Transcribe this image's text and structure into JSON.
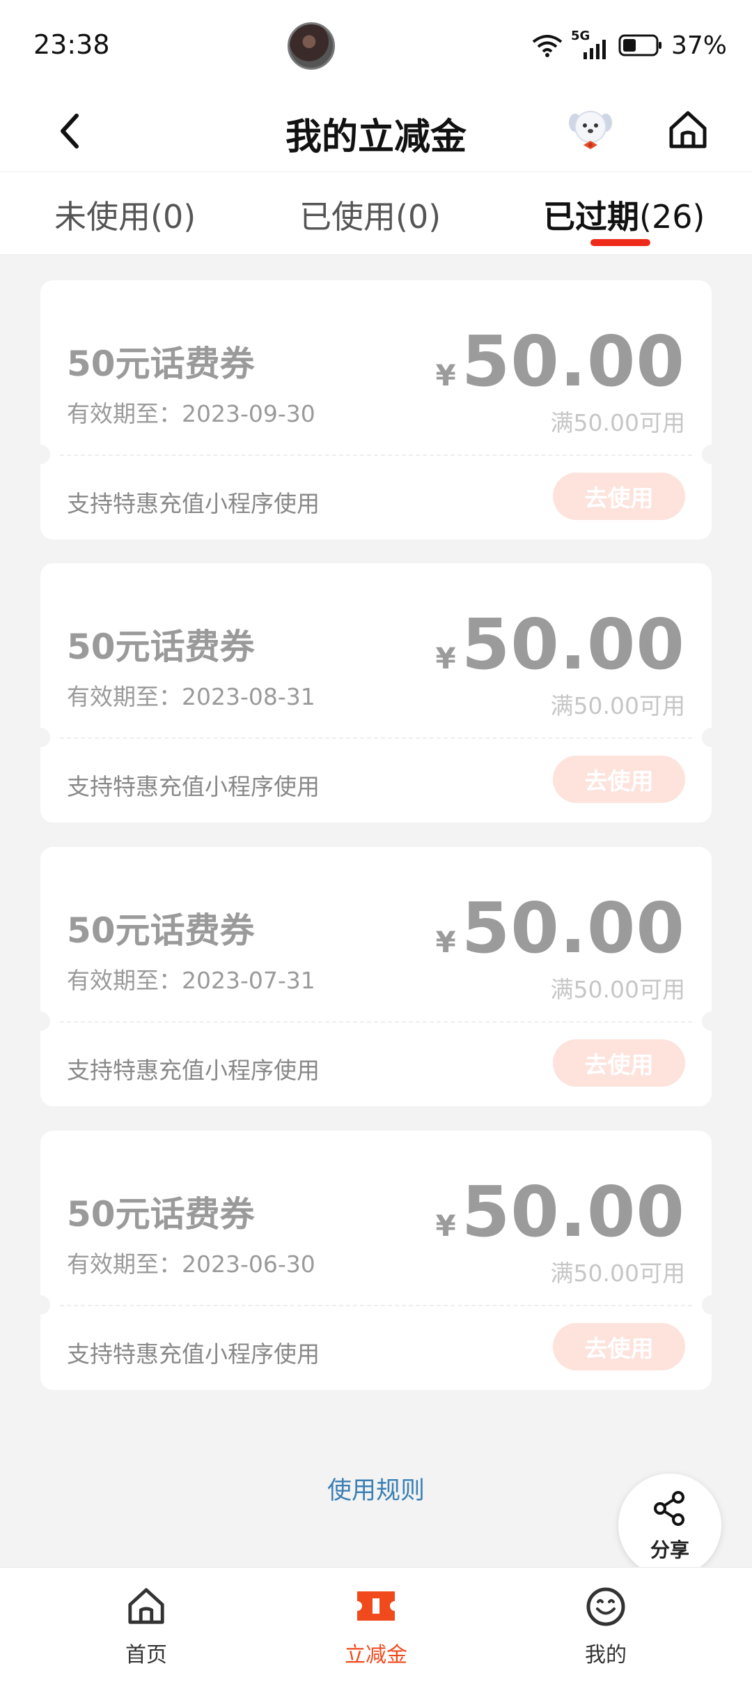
{
  "status": {
    "time": "23:38",
    "network": "5G",
    "battery": "37%"
  },
  "header": {
    "title": "我的立减金"
  },
  "tabs": [
    {
      "label": "未使用",
      "count": "(0)"
    },
    {
      "label": "已使用",
      "count": "(0)"
    },
    {
      "label": "已过期",
      "count": "(26)"
    }
  ],
  "coupons": [
    {
      "title": "50元话费券",
      "expiry": "有效期至：2023-09-30",
      "currency": "¥",
      "amount": "50.00",
      "condition": "满50.00可用",
      "support": "支持特惠充值小程序使用",
      "button": "去使用"
    },
    {
      "title": "50元话费券",
      "expiry": "有效期至：2023-08-31",
      "currency": "¥",
      "amount": "50.00",
      "condition": "满50.00可用",
      "support": "支持特惠充值小程序使用",
      "button": "去使用"
    },
    {
      "title": "50元话费券",
      "expiry": "有效期至：2023-07-31",
      "currency": "¥",
      "amount": "50.00",
      "condition": "满50.00可用",
      "support": "支持特惠充值小程序使用",
      "button": "去使用"
    },
    {
      "title": "50元话费券",
      "expiry": "有效期至：2023-06-30",
      "currency": "¥",
      "amount": "50.00",
      "condition": "满50.00可用",
      "support": "支持特惠充值小程序使用",
      "button": "去使用"
    }
  ],
  "rules_link": "使用规则",
  "share": {
    "label": "分享",
    "icon": "share-icon"
  },
  "bottom_nav": [
    {
      "label": "首页",
      "icon": "home-icon"
    },
    {
      "label": "立减金",
      "icon": "ticket-icon"
    },
    {
      "label": "我的",
      "icon": "smile-icon"
    }
  ],
  "colors": {
    "accent": "#f04a1c",
    "tab_underline": "#ee2a1a",
    "disabled_button": "#fde3dc",
    "link": "#3a7fb5"
  }
}
